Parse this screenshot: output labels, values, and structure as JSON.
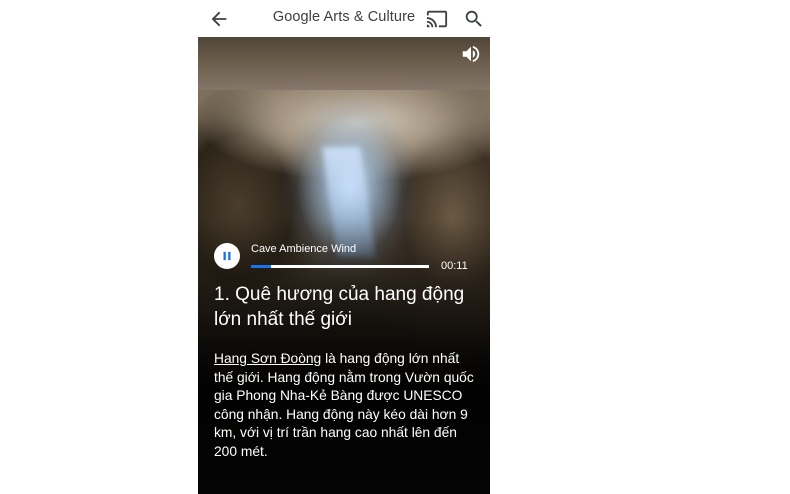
{
  "appbar": {
    "title_google": "Google",
    "title_rest": "Arts & Culture",
    "back_icon": "arrow-back-icon",
    "cast_icon": "cast-icon",
    "search_icon": "search-icon"
  },
  "story": {
    "sound_icon": "volume-icon",
    "player": {
      "track_title": "Cave Ambience Wind",
      "time": "00:11",
      "progress_fraction": 0.11,
      "state_icon": "pause-icon",
      "accent": "#1a73e8"
    },
    "heading": "1. Quê hương của hang động lớn nhất thế giới",
    "body_link": "Hang Sơn Đoòng",
    "body_text": " là hang động lớn nhất thế giới. Hang động nằm trong Vườn quốc gia Phong Nha-Kẻ Bàng được UNESCO công nhận. Hang động này kéo dài hơn 9 km, với vị trí trần hang cao nhất lên đến 200 mét."
  }
}
